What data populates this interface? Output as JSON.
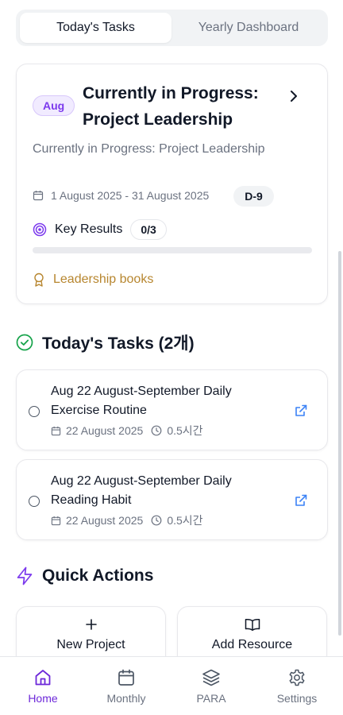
{
  "tabs": [
    {
      "label": "Today's Tasks",
      "active": true
    },
    {
      "label": "Yearly Dashboard",
      "active": false
    }
  ],
  "project": {
    "month_badge": "Aug",
    "title": "Currently in Progress: Project Leadership",
    "description": "Currently in Progress: Project Leadership",
    "date_range": "1 August 2025 - 31 August 2025",
    "dday": "D-9",
    "key_results_label": "Key Results",
    "key_results_count": "0/3",
    "progress_fraction": 0,
    "resource": "Leadership books",
    "icons": {
      "calendar": "calendar-icon",
      "target": "target-icon",
      "award": "award-icon",
      "chevron": "chevron-right-icon"
    }
  },
  "today_tasks": {
    "heading": "Today's Tasks (2개)",
    "items": [
      {
        "title": "Aug 22 August-September Daily Exercise Routine",
        "date": "22 August 2025",
        "duration": "0.5시간"
      },
      {
        "title": "Aug 22 August-September Daily Reading Habit",
        "date": "22 August 2025",
        "duration": "0.5시간"
      }
    ]
  },
  "quick_actions": {
    "heading": "Quick Actions",
    "items": [
      {
        "label": "New Project",
        "icon": "plus-icon"
      },
      {
        "label": "Add Resource",
        "icon": "book-open-icon"
      }
    ]
  },
  "bottom_nav": [
    {
      "label": "Home",
      "icon": "home-icon",
      "active": true
    },
    {
      "label": "Monthly",
      "icon": "calendar-icon",
      "active": false
    },
    {
      "label": "PARA",
      "icon": "layers-icon",
      "active": false
    },
    {
      "label": "Settings",
      "icon": "gear-icon",
      "active": false
    }
  ],
  "colors": {
    "accent": "#7c3aed",
    "success": "#16a34a",
    "resource": "#b7862f",
    "link": "#3b82f6"
  }
}
